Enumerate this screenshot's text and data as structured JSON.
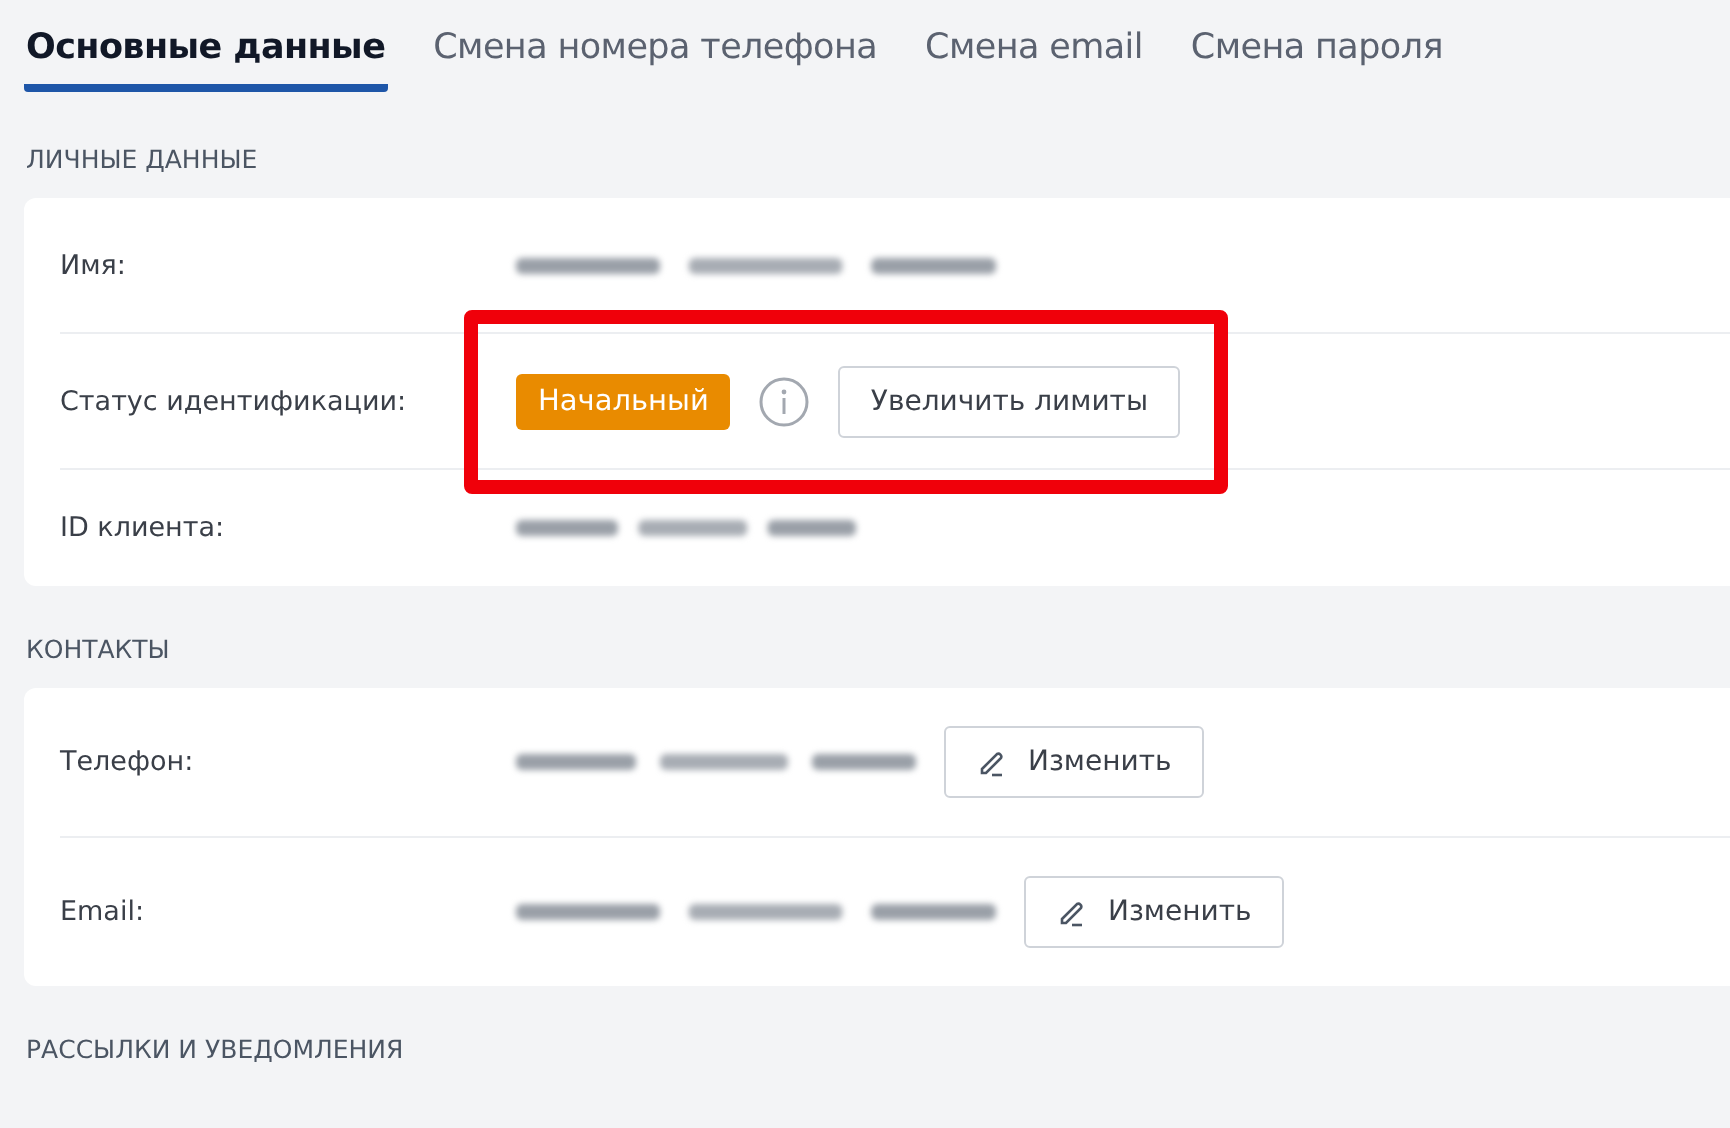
{
  "tabs": [
    {
      "label": "Основные данные",
      "selected": true
    },
    {
      "label": "Смена номера телефона",
      "selected": false
    },
    {
      "label": "Смена email",
      "selected": false
    },
    {
      "label": "Смена пароля",
      "selected": false
    }
  ],
  "sections": [
    {
      "heading": "ЛИЧНЫЕ ДАННЫЕ",
      "rows": [
        {
          "label": "Имя:",
          "kind": "redacted",
          "highlighted": false
        },
        {
          "label": "Статус идентификации:",
          "kind": "status",
          "highlighted": true,
          "badge": "Начальный",
          "info": true,
          "button": "Увеличить лимиты"
        },
        {
          "label": "ID клиента:",
          "kind": "redacted",
          "highlighted": false
        }
      ]
    },
    {
      "heading": "КОНТАКТЫ",
      "rows": [
        {
          "label": "Телефон:",
          "kind": "redacted_edit",
          "highlighted": false,
          "button": "Изменить"
        },
        {
          "label": "Email:",
          "kind": "redacted_edit",
          "highlighted": false,
          "button": "Изменить"
        }
      ]
    },
    {
      "heading": "РАССЫЛКИ И УВЕДОМЛЕНИЯ"
    }
  ]
}
